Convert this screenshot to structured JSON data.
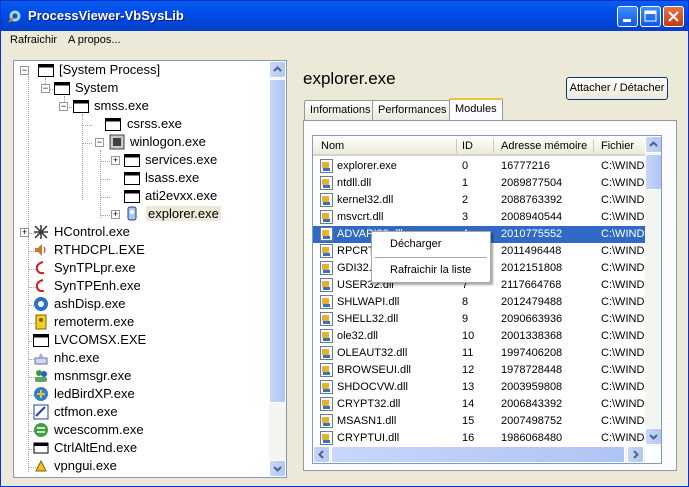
{
  "window": {
    "title": "ProcessViewer-VbSysLib"
  },
  "menu": [
    "Rafraichir",
    "A propos..."
  ],
  "tree": [
    {
      "label": "[System Process]",
      "icon": "window-icon"
    },
    {
      "label": "System",
      "icon": "window-icon"
    },
    {
      "label": "smss.exe",
      "icon": "window-icon"
    },
    {
      "label": "csrss.exe",
      "icon": "window-icon"
    },
    {
      "label": "winlogon.exe",
      "icon": "winlogon-icon"
    },
    {
      "label": "services.exe",
      "icon": "window-icon"
    },
    {
      "label": "lsass.exe",
      "icon": "window-icon"
    },
    {
      "label": "ati2evxx.exe",
      "icon": "window-icon"
    },
    {
      "label": "explorer.exe",
      "icon": "explorer-icon"
    },
    {
      "label": "HControl.exe",
      "icon": "hcontrol-icon"
    },
    {
      "label": "RTHDCPL.EXE",
      "icon": "speaker-icon"
    },
    {
      "label": "SynTPLpr.exe",
      "icon": "synaptics-icon"
    },
    {
      "label": "SynTPEnh.exe",
      "icon": "synaptics-icon"
    },
    {
      "label": "ashDisp.exe",
      "icon": "avast-icon"
    },
    {
      "label": "remoterm.exe",
      "icon": "remote-icon"
    },
    {
      "label": "LVCOMSX.EXE",
      "icon": "window-icon"
    },
    {
      "label": "nhc.exe",
      "icon": "nhc-icon"
    },
    {
      "label": "msnmsgr.exe",
      "icon": "msn-icon"
    },
    {
      "label": "ledBirdXP.exe",
      "icon": "ledbird-icon"
    },
    {
      "label": "ctfmon.exe",
      "icon": "ctfmon-icon"
    },
    {
      "label": "wcescomm.exe",
      "icon": "wcescomm-icon"
    },
    {
      "label": "CtrlAltEnd.exe",
      "icon": "ctrlaltend-icon"
    },
    {
      "label": "vpngui.exe",
      "icon": "vpn-icon"
    }
  ],
  "detail": {
    "process_name": "explorer.exe",
    "attach_button": "Attacher / Détacher",
    "tabs": [
      "Informations",
      "Performances",
      "Modules"
    ],
    "active_tab": "Modules",
    "columns": [
      "Nom",
      "ID",
      "Adresse mémoire",
      "Fichier"
    ],
    "rows": [
      [
        "explorer.exe",
        "0",
        "16777216",
        "C:\\WINDO"
      ],
      [
        "ntdll.dll",
        "1",
        "2089877504",
        "C:\\WINDO"
      ],
      [
        "kernel32.dll",
        "2",
        "2088763392",
        "C:\\WINDO"
      ],
      [
        "msvcrt.dll",
        "3",
        "2008940544",
        "C:\\WINDO"
      ],
      [
        "ADVAPI32.dll",
        "4",
        "2010775552",
        "C:\\WINDO"
      ],
      [
        "RPCRT4.dll",
        "5",
        "2011496448",
        "C:\\WINDO"
      ],
      [
        "GDI32.dll",
        "6",
        "2012151808",
        "C:\\WINDO"
      ],
      [
        "USER32.dll",
        "7",
        "2117664768",
        "C:\\WINDO"
      ],
      [
        "SHLWAPI.dll",
        "8",
        "2012479488",
        "C:\\WINDO"
      ],
      [
        "SHELL32.dll",
        "9",
        "2090663936",
        "C:\\WINDO"
      ],
      [
        "ole32.dll",
        "10",
        "2001338368",
        "C:\\WINDO"
      ],
      [
        "OLEAUT32.dll",
        "11",
        "1997406208",
        "C:\\WINDO"
      ],
      [
        "BROWSEUI.dll",
        "12",
        "1978728448",
        "C:\\WINDO"
      ],
      [
        "SHDOCVW.dll",
        "13",
        "2003959808",
        "C:\\WINDO"
      ],
      [
        "CRYPT32.dll",
        "14",
        "2006843392",
        "C:\\WINDO"
      ],
      [
        "MSASN1.dll",
        "15",
        "2007498752",
        "C:\\WINDO"
      ],
      [
        "CRYPTUI.dll",
        "16",
        "1986068480",
        "C:\\WINDO"
      ]
    ],
    "selected_row": 4
  },
  "context_menu": [
    "Décharger",
    "Rafraichir la liste"
  ]
}
